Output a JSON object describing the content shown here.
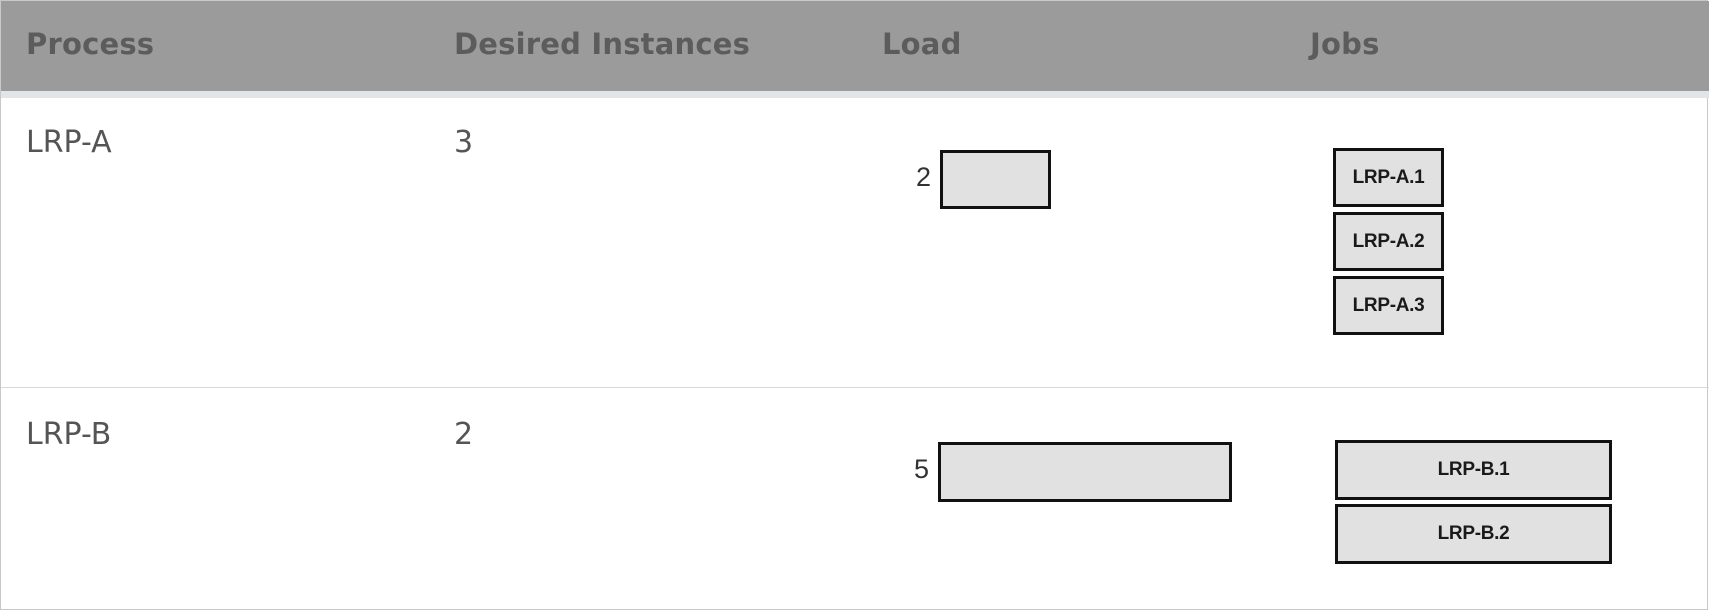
{
  "header": {
    "process": "Process",
    "desired_instances": "Desired Instances",
    "load": "Load",
    "jobs": "Jobs"
  },
  "rows": [
    {
      "process": "LRP-A",
      "desired_instances": "3",
      "load": "2",
      "jobs": [
        "LRP-A.1",
        "LRP-A.2",
        "LRP-A.3"
      ]
    },
    {
      "process": "LRP-B",
      "desired_instances": "2",
      "load": "5",
      "jobs": [
        "LRP-B.1",
        "LRP-B.2"
      ]
    }
  ],
  "colors": {
    "header_bg": "#9b9b9b",
    "header_text": "#5c5c5c",
    "header_strip": "#e2e5e8",
    "cell_text": "#555555",
    "box_fill": "#e1e1e1",
    "box_border": "#111111"
  }
}
